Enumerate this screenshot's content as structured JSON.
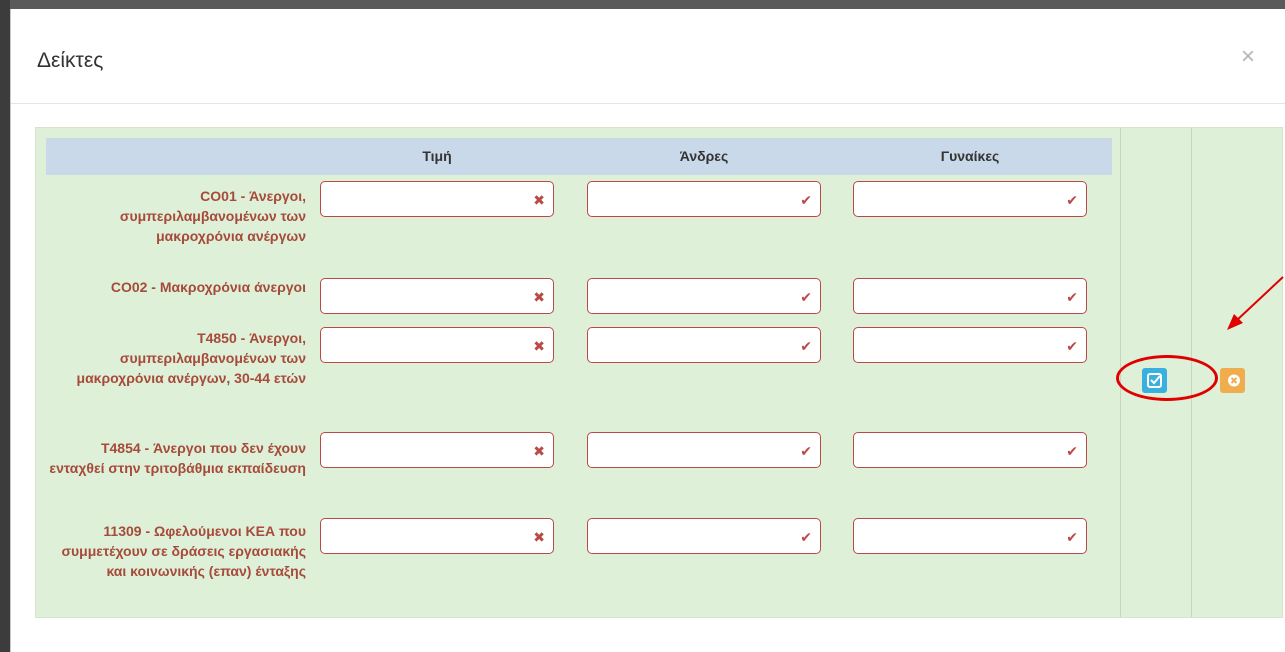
{
  "dialog": {
    "title": "Δείκτες",
    "close_symbol": "×"
  },
  "columns": {
    "value": "Τιμή",
    "men": "Άνδρες",
    "women": "Γυναίκες"
  },
  "rows": [
    {
      "label": "CO01 - Άνεργοι, συμπεριλαμβανομένων των μακροχρόνια ανέργων",
      "value": "",
      "men": "",
      "women": ""
    },
    {
      "label": "CO02 - Μακροχρόνια άνεργοι",
      "value": "",
      "men": "",
      "women": ""
    },
    {
      "label": "T4850 - Άνεργοι, συμπεριλαμβανομένων των μακροχρόνια ανέργων, 30-44 ετών",
      "value": "",
      "men": "",
      "women": ""
    },
    {
      "label": "T4854 - Άνεργοι που δεν έχουν ενταχθεί στην τριτοβάθμια εκπαίδευση",
      "value": "",
      "men": "",
      "women": ""
    },
    {
      "label": "11309 - Ωφελούμενοι ΚΕΑ που συμμετέχουν σε δράσεις εργασιακής και κοινωνικής (επαν) ένταξης",
      "value": "",
      "men": "",
      "women": ""
    }
  ],
  "icons": {
    "value_status": "error-x-icon",
    "men_status": "check-icon",
    "women_status": "check-icon",
    "edit": "edit-icon",
    "cancel": "cancel-x-icon"
  },
  "colors": {
    "panel_bg": "#dff0d8",
    "header_bg": "#c9d9e9",
    "label_text": "#a64a3a",
    "field_border": "#b94a48",
    "edit_btn": "#3ab0de",
    "cancel_btn": "#f0ad4e",
    "annotation": "#e00000"
  }
}
